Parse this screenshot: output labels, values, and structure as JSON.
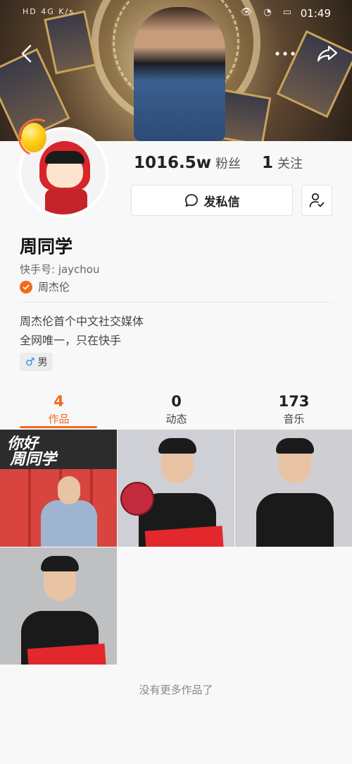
{
  "statusbar": {
    "left_text": "HD 4G K/s",
    "sys_icons": "👁 ◔ ▭",
    "time": "01:49"
  },
  "header": {
    "back_icon": "chevron-left-icon",
    "more_icon": "more-dots-icon",
    "share_icon": "share-arrow-icon"
  },
  "profile": {
    "followers_count": "1016.5w",
    "followers_label": "粉丝",
    "following_count": "1",
    "following_label": "关注",
    "message_label": "发私信",
    "name": "周同学",
    "kuaishou_id": "快手号: jaychou",
    "verified_name": "周杰伦",
    "bio_line1": "周杰伦首个中文社交媒体",
    "bio_line2": "全网唯一，只在快手",
    "gender_symbol": "♂",
    "gender": "男"
  },
  "tabs": [
    {
      "count": "4",
      "label": "作品",
      "active": true
    },
    {
      "count": "0",
      "label": "动态",
      "active": false
    },
    {
      "count": "173",
      "label": "音乐",
      "active": false
    }
  ],
  "thumbnails": {
    "t1_line1": "你好",
    "t1_line2": "周同学"
  },
  "footer": {
    "no_more": "没有更多作品了"
  },
  "colors": {
    "accent": "#f36a1e",
    "background": "#f8f8f8"
  }
}
